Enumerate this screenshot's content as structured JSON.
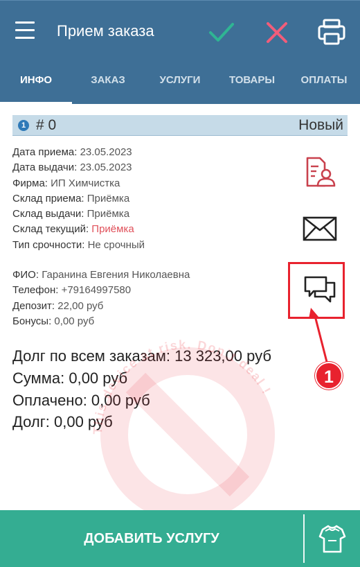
{
  "appbar": {
    "title": "Прием заказа",
    "icons": {
      "menu": "menu-icon",
      "confirm": "check-icon",
      "cancel": "close-icon",
      "print": "printer-icon"
    },
    "colors": {
      "background": "#3e6f96",
      "check": "#2fb593",
      "close": "#f25d7a"
    }
  },
  "tabs": [
    {
      "label": "ИНФО",
      "active": true
    },
    {
      "label": "ЗАКАЗ",
      "active": false
    },
    {
      "label": "УСЛУГИ",
      "active": false
    },
    {
      "label": "ТОВАРЫ",
      "active": false
    },
    {
      "label": "ОПЛАТЫ",
      "active": false
    }
  ],
  "order": {
    "badge": "1",
    "number": "# 0",
    "status": "Новый"
  },
  "details": [
    {
      "label": "Дата приема:",
      "value": "23.05.2023"
    },
    {
      "label": "Дата выдачи:",
      "value": "23.05.2023"
    },
    {
      "label": "Фирма:",
      "value": "ИП Химчистка"
    },
    {
      "label": "Склад приема:",
      "value": "Приёмка"
    },
    {
      "label": "Склад выдачи:",
      "value": "Приёмка"
    },
    {
      "label": "Склад текущий:",
      "value": "Приёмка",
      "highlight": "#e0505a"
    },
    {
      "label": "Тип срочности:",
      "value": "Не срочный"
    }
  ],
  "client": [
    {
      "label": "ФИО:",
      "value": "Гаранина Евгения Николаевна"
    },
    {
      "label": "Телефон:",
      "value": "+79164997580"
    },
    {
      "label": "Депозит:",
      "value": "22,00 руб"
    },
    {
      "label": "Бонусы:",
      "value": "0,00 руб"
    }
  ],
  "totals": [
    {
      "text": "Долг по всем заказам: 13 323,00 руб"
    },
    {
      "text": "Сумма: 0,00 руб"
    },
    {
      "text": "Оплачено: 0,00 руб"
    },
    {
      "text": "Долг: 0,00 руб"
    }
  ],
  "side_actions": {
    "client_card_icon": "client-card-icon",
    "email_icon": "envelope-icon",
    "chat_icon": "chat-icon"
  },
  "annotation": {
    "callout_number": "1",
    "color": "#e8222e"
  },
  "watermark": {
    "text": "This device at risk. Don`t deal !",
    "color": "#e8222e"
  },
  "bottombar": {
    "add_service_label": "ДОБАВИТЬ УСЛУГУ",
    "goods_icon": "clothes-icon",
    "color": "#34ad92"
  }
}
